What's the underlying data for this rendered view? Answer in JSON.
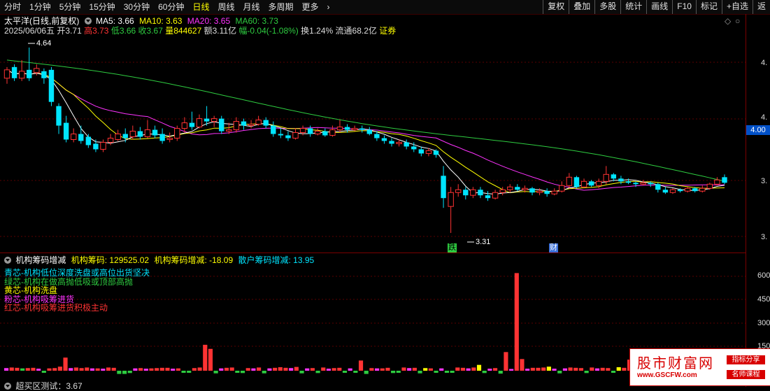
{
  "toolbar": {
    "periods": [
      "分时",
      "1分钟",
      "5分钟",
      "15分钟",
      "30分钟",
      "60分钟",
      "日线",
      "周线",
      "月线",
      "多周期",
      "更多"
    ],
    "active": "日线",
    "buttons": [
      "复权",
      "叠加",
      "多股",
      "统计",
      "画线",
      "F10",
      "标记",
      "+自选",
      "返"
    ]
  },
  "header": {
    "title": "太平洋(日线,前复权)",
    "ma5": "MA5: 3.66",
    "ma10": "MA10: 3.63",
    "ma20": "MA20: 3.65",
    "ma60": "MA60: 3.73",
    "date": "2025/06/06五",
    "open": "开3.71",
    "high": "高3.73",
    "low": "低3.66",
    "close": "收3.67",
    "volume": "量844627",
    "amount": "额3.11亿",
    "change": "幅-0.04(-1.08%)",
    "turnover": "换1.24%",
    "float": "流通68.2亿",
    "sector": "证券"
  },
  "indicator": {
    "title": "机构筹码增减",
    "v1": "机构筹码: 129525.02",
    "v2": "机构筹码增减: -18.09",
    "v3": "散户筹码增减: 13.95",
    "legend": [
      {
        "text": "青芯-机构低位深度洗盘或高位出货坚决",
        "color": "#00e5ff"
      },
      {
        "text": "绿芯-机构在做高抛低吸或顶部高抛",
        "color": "#2ecc40"
      },
      {
        "text": "黄芯-机构洗盘",
        "color": "#ffff00"
      },
      {
        "text": "粉芯-机构吸筹进货",
        "color": "#ff33ff"
      },
      {
        "text": "红芯-机构吸筹进货积极主动",
        "color": "#ff3333"
      }
    ],
    "bottom_label": "超买区测试：3.67"
  },
  "price_axis": {
    "labels": [
      "4.",
      "4.",
      "3.",
      "3."
    ],
    "current": "4.00"
  },
  "vol_axis": {
    "labels": [
      "600",
      "450",
      "300",
      "150"
    ]
  },
  "annotations": {
    "high": "4.64",
    "low": "3.31",
    "mark1": "跌",
    "mark2": "财"
  },
  "watermark": {
    "main": "股市财富网",
    "url": "www.GSCFW.com",
    "tag1": "指标分享",
    "tag2": "名师课程"
  },
  "colors": {
    "up": "#ff3333",
    "down": "#00e5ff",
    "ma5": "#ffffff",
    "ma10": "#ffff00",
    "ma20": "#ff33ff",
    "ma60": "#2ecc40"
  },
  "chart_data": [
    {
      "type": "candlestick",
      "title": "太平洋(日线,前复权)",
      "ylim": [
        3.25,
        4.72
      ],
      "candles": [
        {
          "o": 4.42,
          "c": 4.48,
          "h": 4.5,
          "l": 4.38
        },
        {
          "o": 4.5,
          "c": 4.42,
          "h": 4.52,
          "l": 4.4
        },
        {
          "o": 4.42,
          "c": 4.47,
          "h": 4.55,
          "l": 4.4
        },
        {
          "o": 4.48,
          "c": 4.42,
          "h": 4.64,
          "l": 4.4
        },
        {
          "o": 4.46,
          "c": 4.49,
          "h": 4.52,
          "l": 4.44
        },
        {
          "o": 4.47,
          "c": 4.42,
          "h": 4.49,
          "l": 4.38
        },
        {
          "o": 4.48,
          "c": 4.25,
          "h": 4.5,
          "l": 4.22
        },
        {
          "o": 4.22,
          "c": 4.08,
          "h": 4.24,
          "l": 4.02
        },
        {
          "o": 4.1,
          "c": 3.98,
          "h": 4.15,
          "l": 3.96
        },
        {
          "o": 3.98,
          "c": 4.02,
          "h": 4.06,
          "l": 3.96
        },
        {
          "o": 4.02,
          "c": 3.97,
          "h": 4.08,
          "l": 3.95
        },
        {
          "o": 4.0,
          "c": 3.94,
          "h": 4.02,
          "l": 3.92
        },
        {
          "o": 3.95,
          "c": 3.91,
          "h": 3.98,
          "l": 3.89
        },
        {
          "o": 3.91,
          "c": 3.96,
          "h": 3.98,
          "l": 3.89
        },
        {
          "o": 3.96,
          "c": 3.99,
          "h": 4.02,
          "l": 3.94
        },
        {
          "o": 3.98,
          "c": 4.02,
          "h": 4.05,
          "l": 3.97
        },
        {
          "o": 4.02,
          "c": 3.99,
          "h": 4.06,
          "l": 3.96
        },
        {
          "o": 4.0,
          "c": 4.04,
          "h": 4.08,
          "l": 3.98
        },
        {
          "o": 4.04,
          "c": 4.0,
          "h": 4.07,
          "l": 3.98
        },
        {
          "o": 4.0,
          "c": 4.05,
          "h": 4.12,
          "l": 3.99
        },
        {
          "o": 4.05,
          "c": 4.01,
          "h": 4.08,
          "l": 3.99
        },
        {
          "o": 4.02,
          "c": 3.97,
          "h": 4.06,
          "l": 3.95
        },
        {
          "o": 3.98,
          "c": 3.99,
          "h": 4.03,
          "l": 3.96
        },
        {
          "o": 3.99,
          "c": 4.06,
          "h": 4.08,
          "l": 3.97
        },
        {
          "o": 4.06,
          "c": 4.1,
          "h": 4.14,
          "l": 4.03
        },
        {
          "o": 4.1,
          "c": 4.07,
          "h": 4.18,
          "l": 4.05
        },
        {
          "o": 4.07,
          "c": 4.13,
          "h": 4.16,
          "l": 4.06
        },
        {
          "o": 4.13,
          "c": 4.11,
          "h": 4.22,
          "l": 4.08
        },
        {
          "o": 4.11,
          "c": 4.13,
          "h": 4.15,
          "l": 4.07
        },
        {
          "o": 4.13,
          "c": 4.04,
          "h": 4.15,
          "l": 4.02
        },
        {
          "o": 4.04,
          "c": 4.05,
          "h": 4.1,
          "l": 4.02
        },
        {
          "o": 4.05,
          "c": 4.11,
          "h": 4.14,
          "l": 4.03
        },
        {
          "o": 4.11,
          "c": 4.08,
          "h": 4.13,
          "l": 4.05
        },
        {
          "o": 4.08,
          "c": 4.09,
          "h": 4.12,
          "l": 4.06
        },
        {
          "o": 4.09,
          "c": 4.12,
          "h": 4.15,
          "l": 4.08
        },
        {
          "o": 4.12,
          "c": 4.08,
          "h": 4.14,
          "l": 4.06
        },
        {
          "o": 4.08,
          "c": 4.02,
          "h": 4.11,
          "l": 4.0
        },
        {
          "o": 4.02,
          "c": 4.01,
          "h": 4.06,
          "l": 3.99
        },
        {
          "o": 4.01,
          "c": 3.99,
          "h": 4.04,
          "l": 3.97
        },
        {
          "o": 3.99,
          "c": 4.03,
          "h": 4.06,
          "l": 3.98
        },
        {
          "o": 4.03,
          "c": 4.06,
          "h": 4.08,
          "l": 4.01
        },
        {
          "o": 4.06,
          "c": 4.02,
          "h": 4.08,
          "l": 4.0
        },
        {
          "o": 4.02,
          "c": 4.04,
          "h": 4.06,
          "l": 4.01
        },
        {
          "o": 4.04,
          "c": 4.01,
          "h": 4.06,
          "l": 4.0
        },
        {
          "o": 4.01,
          "c": 4.05,
          "h": 4.08,
          "l": 4.0
        },
        {
          "o": 4.05,
          "c": 4.07,
          "h": 4.12,
          "l": 4.03
        },
        {
          "o": 4.07,
          "c": 4.05,
          "h": 4.09,
          "l": 4.03
        },
        {
          "o": 4.05,
          "c": 4.06,
          "h": 4.08,
          "l": 4.04
        },
        {
          "o": 4.06,
          "c": 4.05,
          "h": 4.08,
          "l": 4.03
        },
        {
          "o": 4.05,
          "c": 4.02,
          "h": 4.07,
          "l": 4.01
        },
        {
          "o": 4.02,
          "c": 3.99,
          "h": 4.04,
          "l": 3.97
        },
        {
          "o": 3.99,
          "c": 3.97,
          "h": 4.01,
          "l": 3.95
        },
        {
          "o": 3.97,
          "c": 3.95,
          "h": 3.99,
          "l": 3.93
        },
        {
          "o": 3.95,
          "c": 3.96,
          "h": 3.98,
          "l": 3.93
        },
        {
          "o": 3.96,
          "c": 3.93,
          "h": 3.98,
          "l": 3.91
        },
        {
          "o": 3.93,
          "c": 3.91,
          "h": 3.96,
          "l": 3.89
        },
        {
          "o": 3.91,
          "c": 3.88,
          "h": 3.93,
          "l": 3.86
        },
        {
          "o": 3.88,
          "c": 3.9,
          "h": 3.92,
          "l": 3.86
        },
        {
          "o": 3.9,
          "c": 3.87,
          "h": 3.91,
          "l": 3.85
        },
        {
          "o": 3.72,
          "c": 3.56,
          "h": 3.79,
          "l": 3.49
        },
        {
          "o": 3.5,
          "c": 3.6,
          "h": 3.64,
          "l": 3.31
        },
        {
          "o": 3.6,
          "c": 3.62,
          "h": 3.66,
          "l": 3.57
        },
        {
          "o": 3.62,
          "c": 3.58,
          "h": 3.64,
          "l": 3.55
        },
        {
          "o": 3.58,
          "c": 3.62,
          "h": 3.64,
          "l": 3.56
        },
        {
          "o": 3.62,
          "c": 3.58,
          "h": 3.64,
          "l": 3.56
        },
        {
          "o": 3.58,
          "c": 3.56,
          "h": 3.61,
          "l": 3.54
        },
        {
          "o": 3.56,
          "c": 3.6,
          "h": 3.62,
          "l": 3.55
        },
        {
          "o": 3.6,
          "c": 3.62,
          "h": 3.64,
          "l": 3.58
        },
        {
          "o": 3.62,
          "c": 3.64,
          "h": 3.66,
          "l": 3.6
        },
        {
          "o": 3.64,
          "c": 3.62,
          "h": 3.66,
          "l": 3.61
        },
        {
          "o": 3.62,
          "c": 3.63,
          "h": 3.65,
          "l": 3.6
        },
        {
          "o": 3.63,
          "c": 3.6,
          "h": 3.64,
          "l": 3.58
        },
        {
          "o": 3.6,
          "c": 3.61,
          "h": 3.63,
          "l": 3.58
        },
        {
          "o": 3.61,
          "c": 3.59,
          "h": 3.63,
          "l": 3.57
        },
        {
          "o": 3.59,
          "c": 3.61,
          "h": 3.63,
          "l": 3.58
        },
        {
          "o": 3.61,
          "c": 3.65,
          "h": 3.68,
          "l": 3.6
        },
        {
          "o": 3.65,
          "c": 3.71,
          "h": 3.74,
          "l": 3.63
        },
        {
          "o": 3.71,
          "c": 3.64,
          "h": 3.72,
          "l": 3.63
        },
        {
          "o": 3.64,
          "c": 3.68,
          "h": 3.7,
          "l": 3.63
        },
        {
          "o": 3.68,
          "c": 3.65,
          "h": 3.69,
          "l": 3.64
        },
        {
          "o": 3.65,
          "c": 3.68,
          "h": 3.7,
          "l": 3.63
        },
        {
          "o": 3.68,
          "c": 3.73,
          "h": 3.79,
          "l": 3.66
        },
        {
          "o": 3.73,
          "c": 3.7,
          "h": 3.74,
          "l": 3.68
        },
        {
          "o": 3.7,
          "c": 3.68,
          "h": 3.72,
          "l": 3.66
        },
        {
          "o": 3.68,
          "c": 3.67,
          "h": 3.7,
          "l": 3.66
        },
        {
          "o": 3.67,
          "c": 3.66,
          "h": 3.68,
          "l": 3.64
        },
        {
          "o": 3.66,
          "c": 3.67,
          "h": 3.69,
          "l": 3.65
        },
        {
          "o": 3.67,
          "c": 3.66,
          "h": 3.68,
          "l": 3.64
        },
        {
          "o": 3.66,
          "c": 3.62,
          "h": 3.67,
          "l": 3.6
        },
        {
          "o": 3.62,
          "c": 3.6,
          "h": 3.64,
          "l": 3.59
        },
        {
          "o": 3.6,
          "c": 3.62,
          "h": 3.63,
          "l": 3.59
        },
        {
          "o": 3.62,
          "c": 3.61,
          "h": 3.63,
          "l": 3.6
        },
        {
          "o": 3.61,
          "c": 3.63,
          "h": 3.64,
          "l": 3.6
        },
        {
          "o": 3.63,
          "c": 3.61,
          "h": 3.64,
          "l": 3.6
        },
        {
          "o": 3.61,
          "c": 3.63,
          "h": 3.65,
          "l": 3.6
        },
        {
          "o": 3.63,
          "c": 3.66,
          "h": 3.67,
          "l": 3.62
        },
        {
          "o": 3.66,
          "c": 3.69,
          "h": 3.71,
          "l": 3.65
        },
        {
          "o": 3.71,
          "c": 3.67,
          "h": 3.73,
          "l": 3.66
        }
      ],
      "ma_lines": [
        "MA5",
        "MA10",
        "MA20",
        "MA60"
      ]
    },
    {
      "type": "bar",
      "title": "机构筹码增减",
      "ylim": [
        0,
        720
      ],
      "values": [
        18,
        22,
        20,
        16,
        18,
        20,
        14,
        -14,
        16,
        18,
        28,
        90,
        18,
        22,
        18,
        22,
        16,
        16,
        14,
        22,
        20,
        -22,
        -22,
        -16,
        16,
        18,
        14,
        16,
        18,
        20,
        20,
        14,
        16,
        -12,
        -14,
        18,
        22,
        178,
        150,
        -18,
        16,
        20,
        22,
        -14,
        -16,
        18,
        16,
        22,
        -18,
        16,
        20,
        24,
        20,
        18,
        26,
        -18,
        16,
        18,
        -16,
        22,
        14,
        18,
        20,
        -14,
        16,
        -14,
        70,
        -22,
        18,
        16,
        16,
        20,
        -16,
        -14,
        22,
        18,
        20,
        -18,
        18,
        16,
        -14,
        16,
        -14,
        -12,
        22,
        20,
        16,
        22,
        40,
        -16,
        14,
        18,
        -20,
        128,
        12,
        670,
        80,
        14,
        20,
        20,
        22,
        28,
        14,
        -18,
        16,
        22,
        20,
        18,
        -16,
        22,
        16,
        20,
        18,
        -14,
        24,
        20,
        76,
        24,
        18,
        -16,
        16,
        20,
        -14,
        22,
        18,
        -16,
        16,
        20,
        18,
        150,
        20,
        16,
        14,
        18,
        -14,
        16,
        20,
        -18
      ],
      "colors": [
        "#ff33ff",
        "#ff3333",
        "#ff3333",
        "#2ecc40",
        "#ff3333",
        "#ff3333",
        "#ff33ff",
        "#2ecc40",
        "#ff3333",
        "#ff3333",
        "#ff3333",
        "#ff3333",
        "#ff33ff",
        "#ff3333",
        "#ff3333",
        "#ff3333",
        "#ff33ff",
        "#ff3333",
        "#ff33ff",
        "#ff3333",
        "#ff3333",
        "#2ecc40",
        "#2ecc40",
        "#2ecc40",
        "#ff33ff",
        "#ff3333",
        "#ff33ff",
        "#ff3333",
        "#ff3333",
        "#ff3333",
        "#ff3333",
        "#ff33ff",
        "#ff3333",
        "#2ecc40",
        "#2ecc40",
        "#ff3333",
        "#ff3333",
        "#ff3333",
        "#ff3333",
        "#2ecc40",
        "#ff33ff",
        "#ff3333",
        "#ff3333",
        "#2ecc40",
        "#2ecc40",
        "#ff3333",
        "#ff33ff",
        "#ff3333",
        "#2ecc40",
        "#ff33ff",
        "#ff3333",
        "#ff3333",
        "#ff3333",
        "#ff33ff",
        "#ff3333",
        "#2ecc40",
        "#ff33ff",
        "#ff3333",
        "#2ecc40",
        "#ff3333",
        "#ff33ff",
        "#ff3333",
        "#ff3333",
        "#2ecc40",
        "#ff33ff",
        "#2ecc40",
        "#ff3333",
        "#2ecc40",
        "#ff3333",
        "#ff33ff",
        "#ff3333",
        "#ff3333",
        "#2ecc40",
        "#2ecc40",
        "#ff3333",
        "#ff33ff",
        "#ff3333",
        "#2ecc40",
        "#ffff00",
        "#ff3333",
        "#2ecc40",
        "#ff33ff",
        "#2ecc40",
        "#2ecc40",
        "#ff3333",
        "#ff3333",
        "#ff33ff",
        "#ff3333",
        "#ffff00",
        "#2ecc40",
        "#ff33ff",
        "#ff3333",
        "#2ecc40",
        "#ff3333",
        "#ff33ff",
        "#ff3333",
        "#ff3333",
        "#ff33ff",
        "#ff3333",
        "#ff3333",
        "#ff3333",
        "#ffff00",
        "#ff33ff",
        "#2ecc40",
        "#ff33ff",
        "#ff3333",
        "#ff3333",
        "#ff3333",
        "#2ecc40",
        "#ff3333",
        "#ff33ff",
        "#ff3333",
        "#ff3333",
        "#2ecc40",
        "#ffff00",
        "#ff3333",
        "#ff3333",
        "#ff3333",
        "#ff3333",
        "#2ecc40",
        "#ff33ff",
        "#ff3333",
        "#2ecc40",
        "#ff3333",
        "#ff33ff",
        "#2ecc40",
        "#ff33ff",
        "#ff3333",
        "#ff3333",
        "#ff3333",
        "#ff3333",
        "#ff33ff",
        "#ff3333",
        "#ff3333",
        "#2ecc40",
        "#ff33ff",
        "#ff3333",
        "#2ecc40"
      ]
    }
  ]
}
